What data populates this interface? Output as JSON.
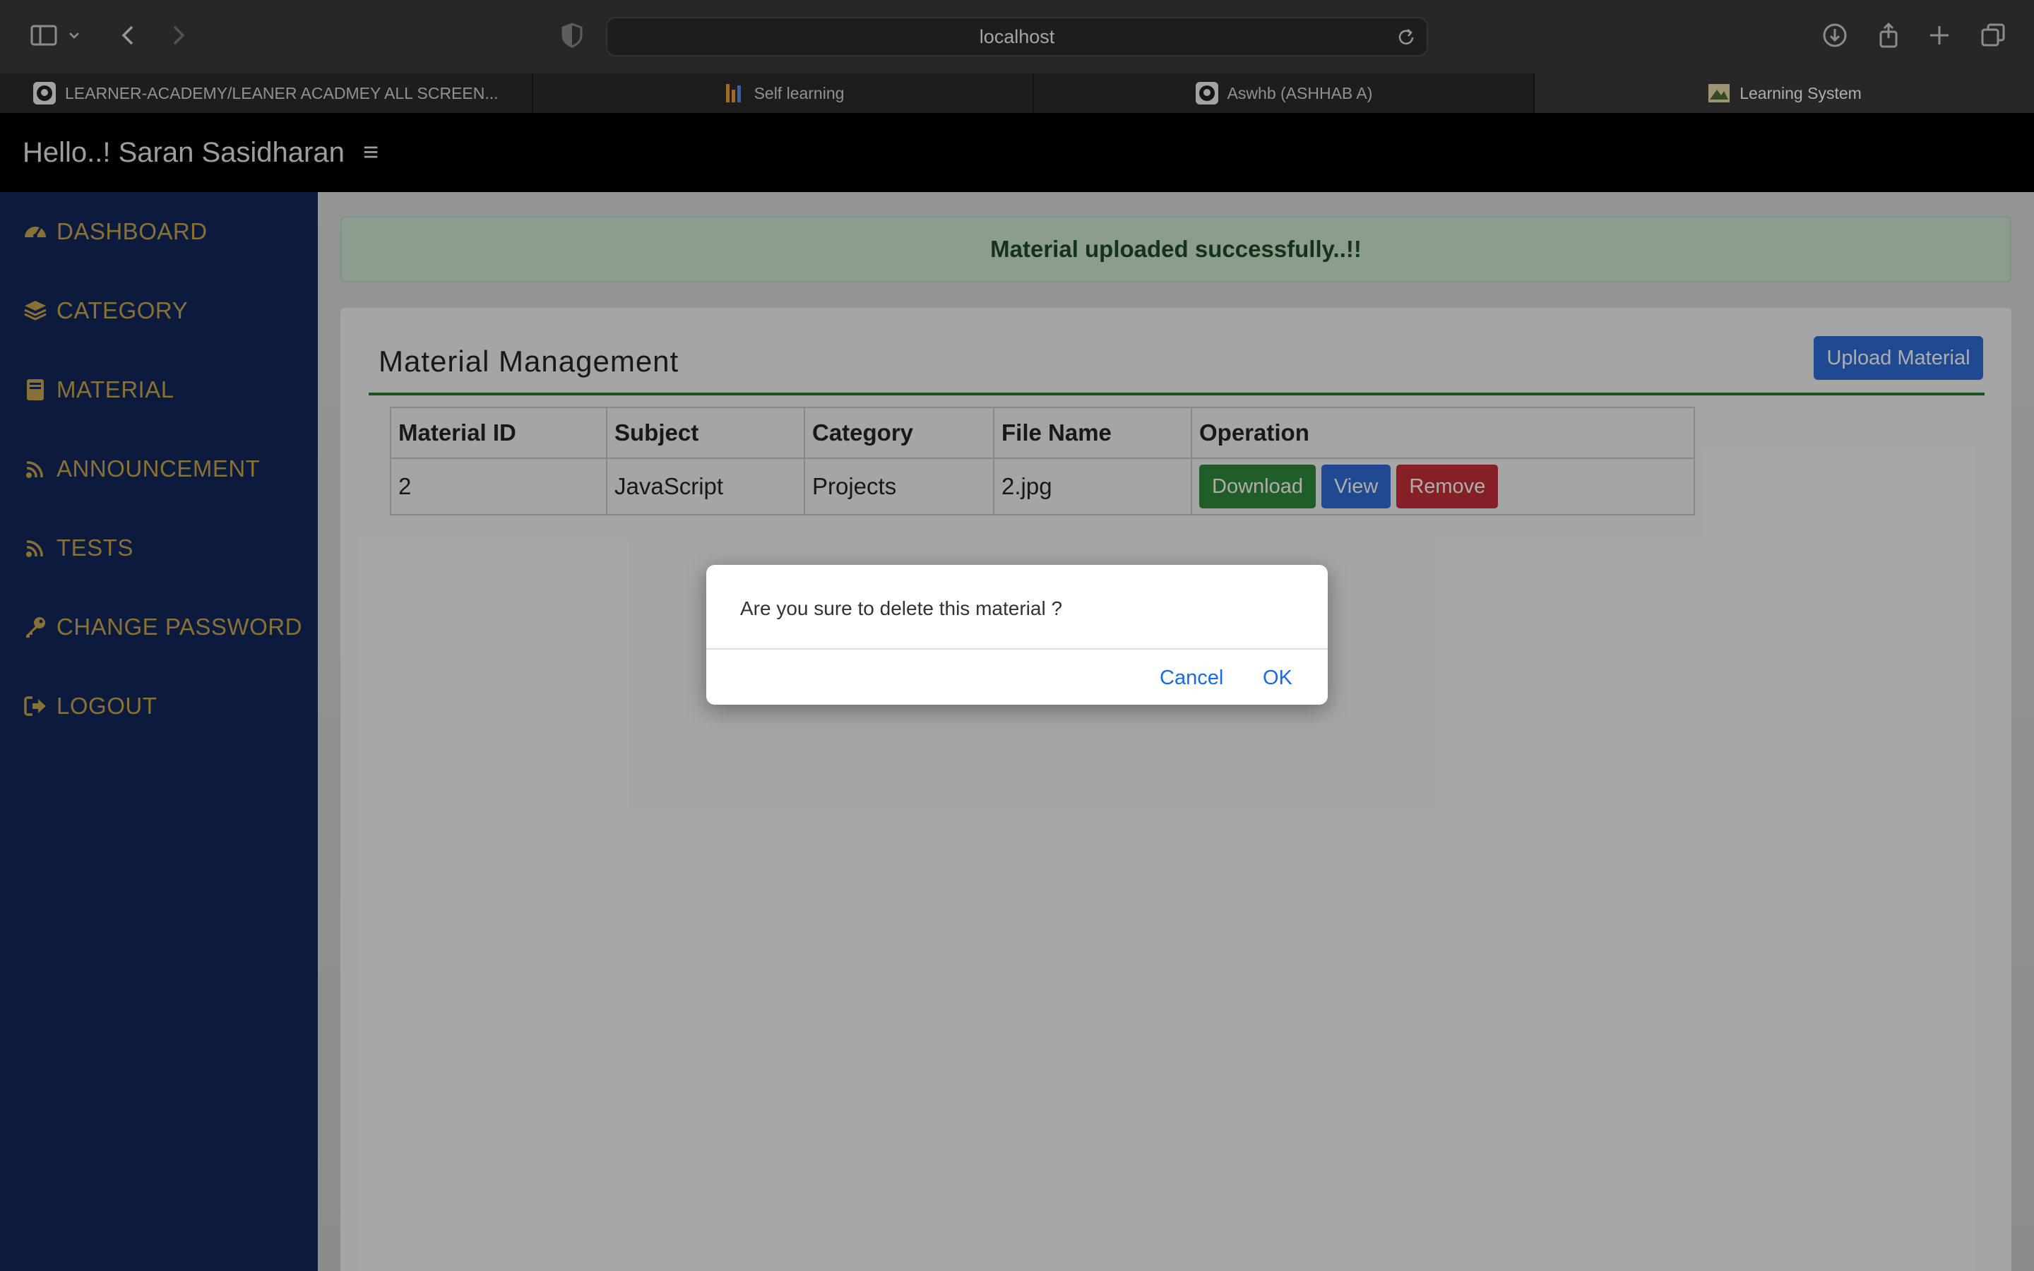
{
  "browser": {
    "url": "localhost",
    "tabs": [
      {
        "title": "LEARNER-ACADEMY/LEANER ACADMEY ALL SCREEN...",
        "favicon": "github-icon"
      },
      {
        "title": "Self learning",
        "favicon": "bars-icon"
      },
      {
        "title": "Aswhb (ASHHAB A)",
        "favicon": "github-icon"
      },
      {
        "title": "Learning System",
        "favicon": "site-icon"
      }
    ]
  },
  "header": {
    "greeting": "Hello..! Saran Sasidharan",
    "menu_icon": "≡"
  },
  "sidebar": {
    "items": [
      {
        "label": "DASHBOARD",
        "icon": "dashboard-icon"
      },
      {
        "label": "CATEGORY",
        "icon": "layers-icon"
      },
      {
        "label": "MATERIAL",
        "icon": "book-icon"
      },
      {
        "label": "ANNOUNCEMENT",
        "icon": "broadcast-icon"
      },
      {
        "label": "TESTS",
        "icon": "broadcast-icon"
      },
      {
        "label": "CHANGE PASSWORD",
        "icon": "key-icon"
      },
      {
        "label": "LOGOUT",
        "icon": "logout-icon"
      }
    ]
  },
  "alert": {
    "message": "Material uploaded successfully..!!"
  },
  "card": {
    "title": "Material Management",
    "upload_label": "Upload Material"
  },
  "table": {
    "headers": [
      "Material ID",
      "Subject",
      "Category",
      "File Name",
      "Operation"
    ],
    "rows": [
      {
        "id": "2",
        "subject": "JavaScript",
        "category": "Projects",
        "file": "2.jpg"
      }
    ],
    "actions": {
      "download": "Download",
      "view": "View",
      "remove": "Remove"
    }
  },
  "dialog": {
    "message": "Are you sure to delete this material ?",
    "cancel_label": "Cancel",
    "ok_label": "OK"
  },
  "colors": {
    "sidebar_bg": "#13275b",
    "sidebar_text": "#c9a74e",
    "primary": "#2f6cd6",
    "success": "#2e8b3b",
    "danger": "#c6303a"
  }
}
